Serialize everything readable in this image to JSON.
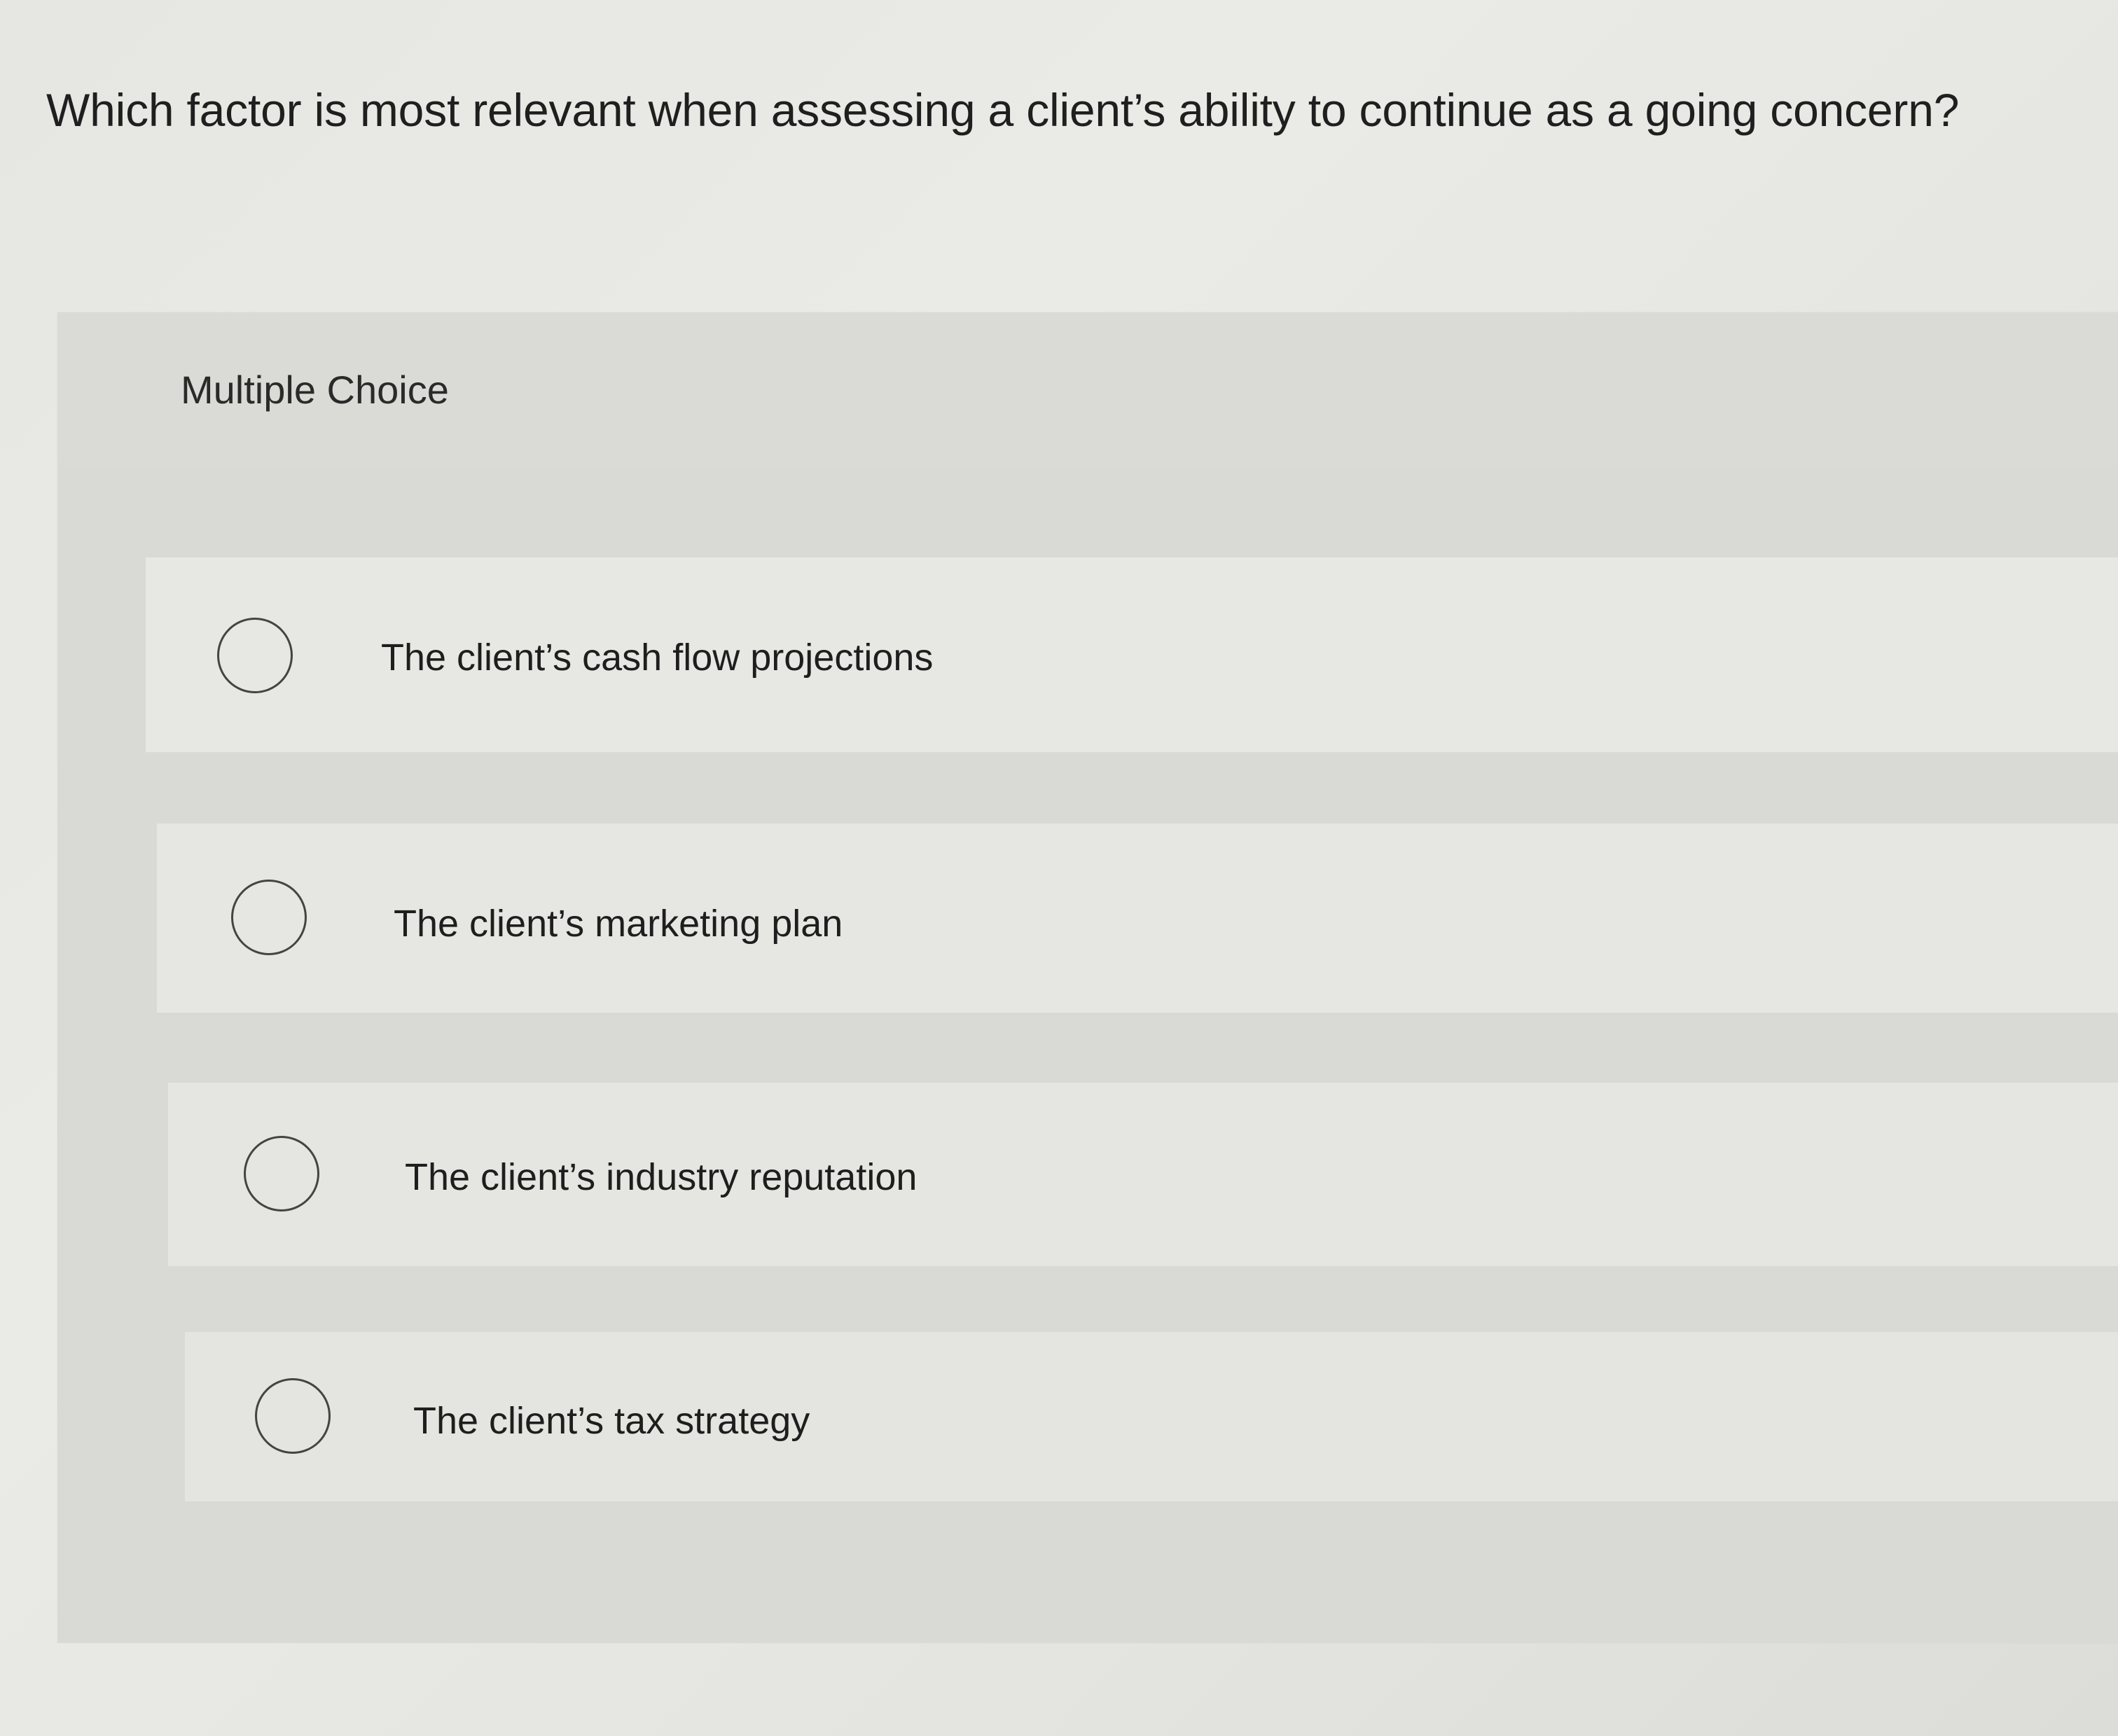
{
  "question": {
    "text": "Which factor is most relevant when assessing a client’s ability to continue as a going concern?"
  },
  "panel": {
    "header_label": "Multiple Choice"
  },
  "options": [
    {
      "label": "The client’s cash flow projections",
      "selected": false
    },
    {
      "label": "The client’s marketing plan",
      "selected": false
    },
    {
      "label": "The client’s industry reputation",
      "selected": false
    },
    {
      "label": "The client’s tax strategy",
      "selected": false
    }
  ],
  "colors": {
    "background": "#e6e6e2",
    "panel": "#dcdcd8",
    "option_row": "#e6e6e2",
    "text": "#1f1f1f",
    "radio_border": "#444444"
  }
}
